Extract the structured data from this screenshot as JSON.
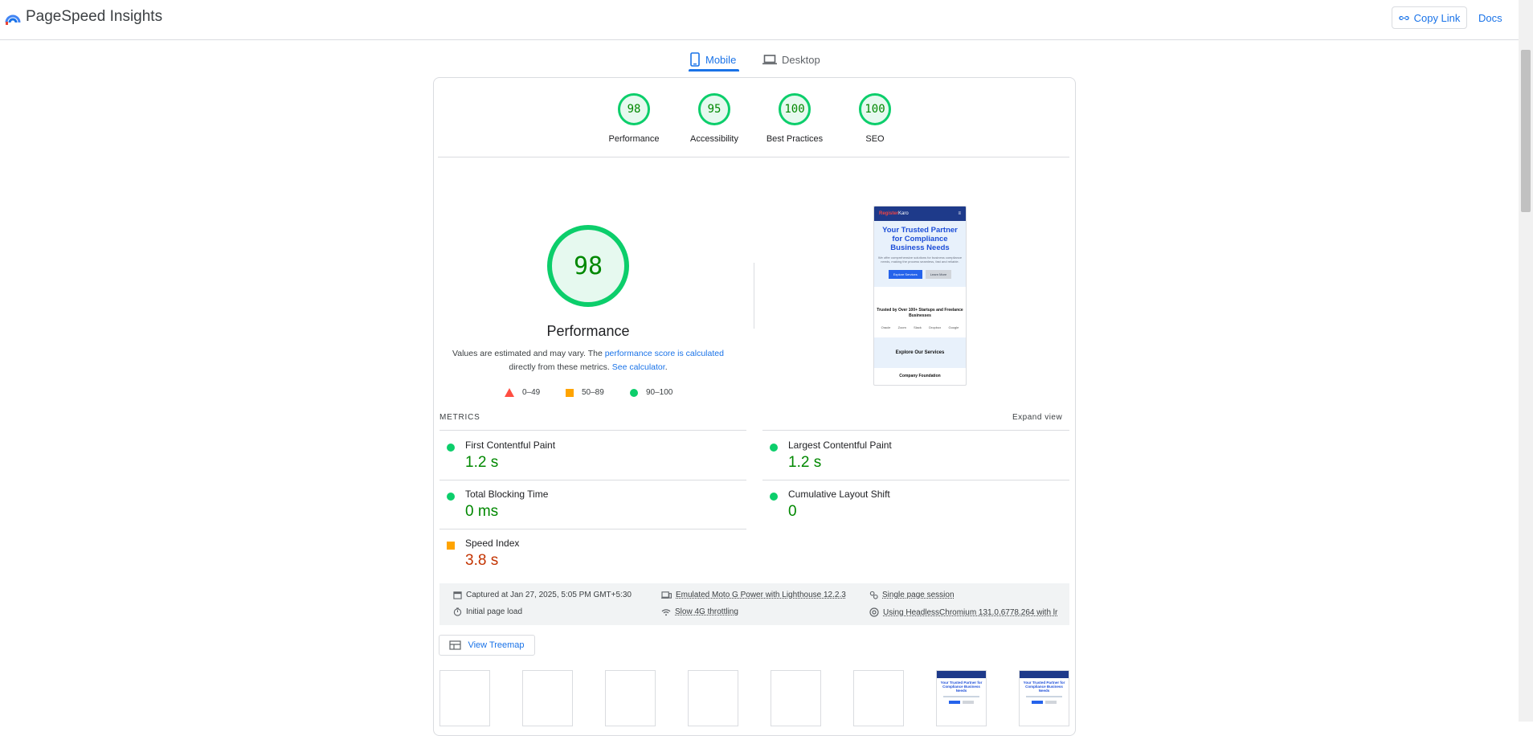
{
  "header": {
    "brand": "PageSpeed Insights",
    "copy_link": "Copy Link",
    "docs": "Docs"
  },
  "tabs": [
    {
      "label": "Mobile",
      "selected": true
    },
    {
      "label": "Desktop",
      "selected": false
    }
  ],
  "categories": [
    {
      "score": "98",
      "label": "Performance"
    },
    {
      "score": "95",
      "label": "Accessibility"
    },
    {
      "score": "100",
      "label": "Best Practices"
    },
    {
      "score": "100",
      "label": "SEO"
    }
  ],
  "performance": {
    "score": "98",
    "title": "Performance",
    "desc_1": "Values are estimated and may vary. The ",
    "desc_link_1": "performance score is calculated",
    "desc_2": "directly from these metrics. ",
    "desc_link_2": "See calculator",
    "desc_3": ".",
    "legend": {
      "fail": "0–49",
      "average": "50–89",
      "pass": "90–100"
    }
  },
  "screenshot": {
    "brand_a": "Register",
    "brand_b": "Karo",
    "heading": "Your Trusted Partner for Compliance Business Needs",
    "sub": "We offer comprehensive solutions for business compliance needs, making the process seamless, fast and reliable.",
    "btn_primary": "Explore Services",
    "btn_secondary": "Learn More",
    "trusted": "Trusted by Over 100+ Startups and Freelance Businesses",
    "logos": [
      "Oracle",
      "Zoom",
      "Slack",
      "Dropbox",
      "Google"
    ],
    "services": "Explore Our Services",
    "foundation": "Company Foundation"
  },
  "metrics": {
    "heading": "METRICS",
    "expand": "Expand view",
    "items": [
      {
        "name": "First Contentful Paint",
        "value": "1.2 s",
        "rating": "pass"
      },
      {
        "name": "Largest Contentful Paint",
        "value": "1.2 s",
        "rating": "pass"
      },
      {
        "name": "Total Blocking Time",
        "value": "0 ms",
        "rating": "pass"
      },
      {
        "name": "Cumulative Layout Shift",
        "value": "0",
        "rating": "pass"
      },
      {
        "name": "Speed Index",
        "value": "3.8 s",
        "rating": "average"
      }
    ]
  },
  "runtime": {
    "captured": "Captured at Jan 27, 2025, 5:05 PM GMT+5:30",
    "device": "Emulated Moto G Power with Lighthouse 12.2.3",
    "session": "Single page session",
    "load": "Initial page load",
    "throttling": "Slow 4G throttling",
    "browser": "Using HeadlessChromium 131.0.6778.264 with lr"
  },
  "treemap": {
    "label": "View Treemap"
  },
  "colors": {
    "pass": "#0cce6b",
    "average": "#ffa400",
    "fail": "#ff4e42",
    "link": "#1a73e8"
  }
}
